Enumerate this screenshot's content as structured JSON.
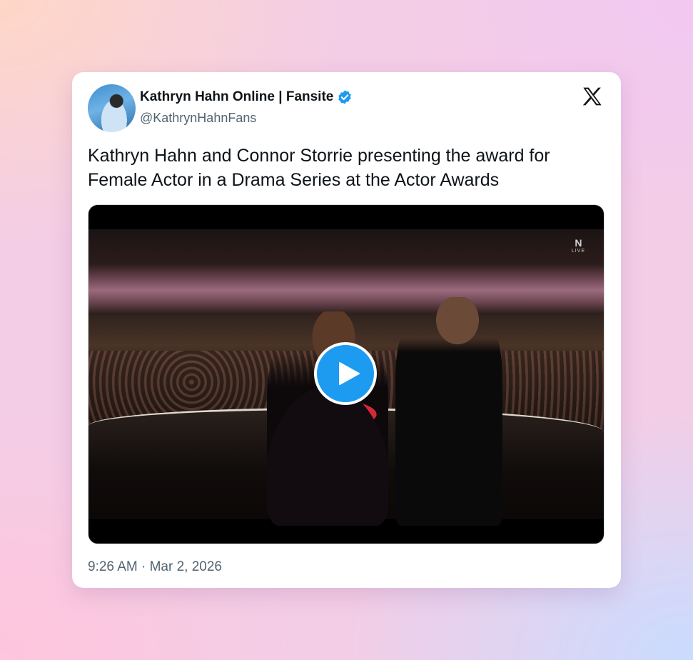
{
  "tweet": {
    "display_name": "Kathryn Hahn Online | Fansite",
    "handle": "@KathrynHahnFans",
    "text": "Kathryn Hahn and Connor Storrie presenting the award for Female Actor in a Drama Series at the Actor Awards",
    "timestamp": "9:26 AM · Mar 2, 2026",
    "verified": true
  },
  "video": {
    "badge_logo": "N",
    "badge_label": "LIVE"
  },
  "icons": {
    "brand": "x-logo-icon",
    "verified": "verified-badge-icon",
    "play": "play-icon"
  },
  "colors": {
    "accent": "#1d9bf0",
    "text_primary": "#0f1419",
    "text_secondary": "#536471"
  }
}
